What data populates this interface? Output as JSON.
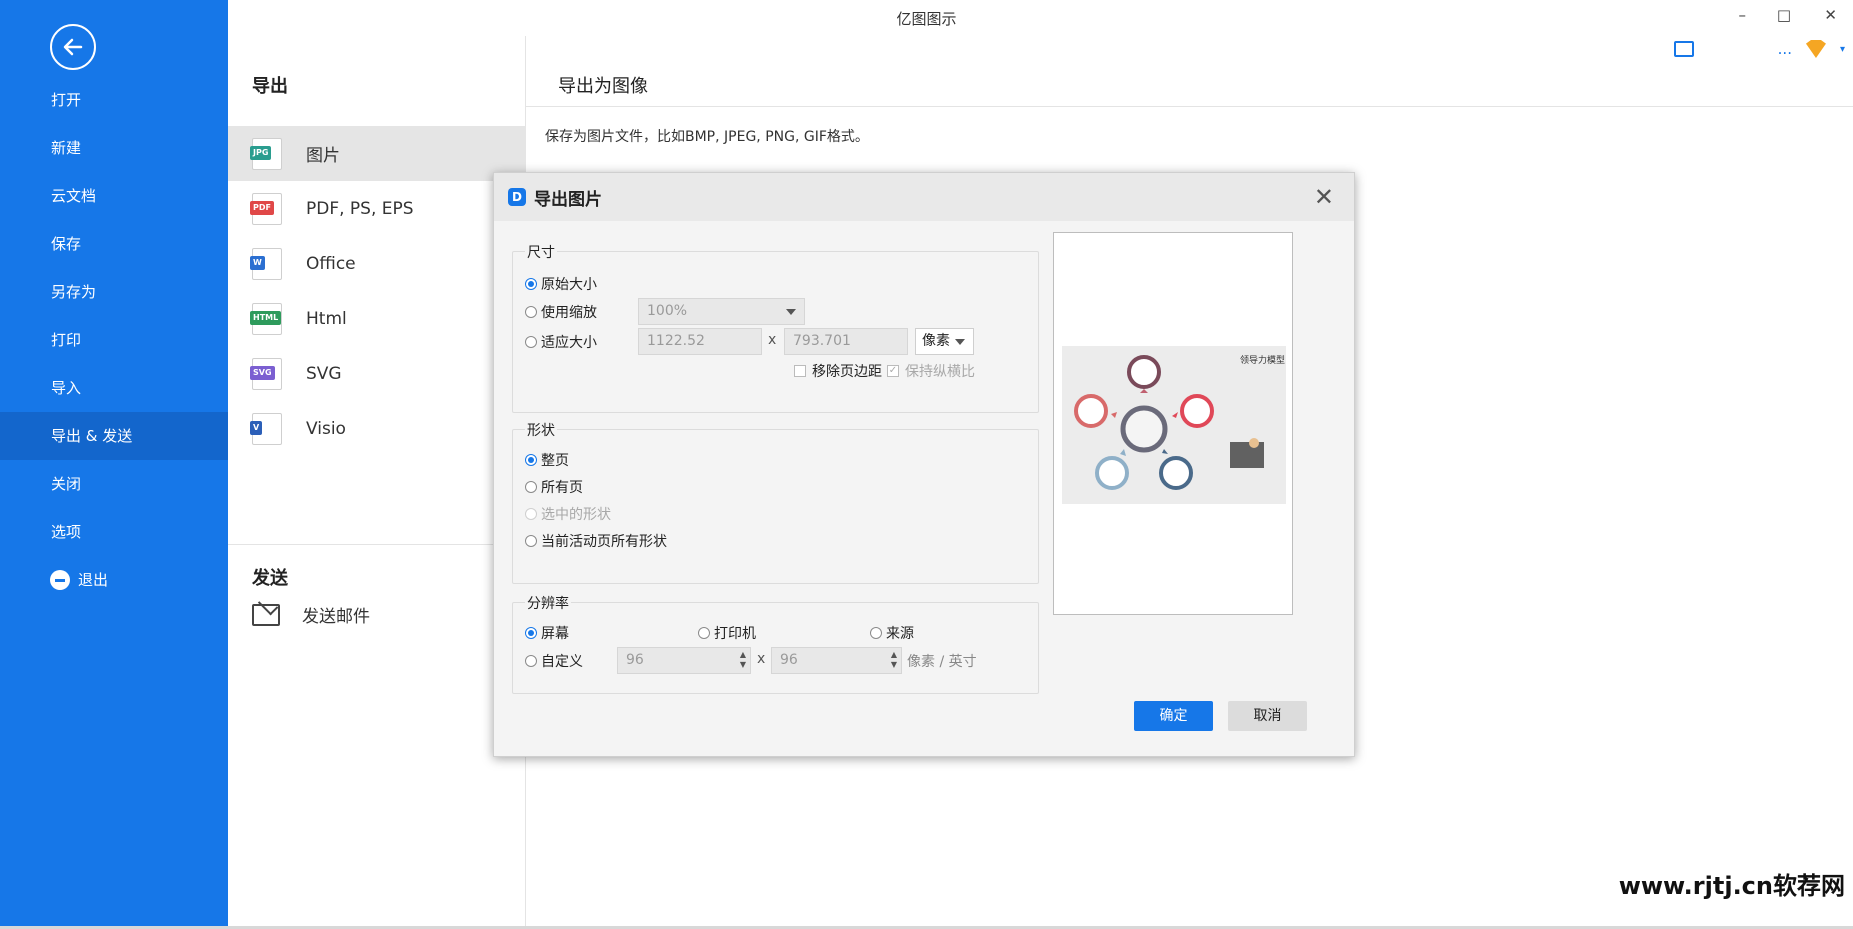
{
  "app": {
    "title": "亿图图示"
  },
  "titlebar": {
    "min": "–",
    "max": "□",
    "close": "✕",
    "more": "...",
    "caret": "▾"
  },
  "sidebar": {
    "items": [
      {
        "label": "打开"
      },
      {
        "label": "新建"
      },
      {
        "label": "云文档"
      },
      {
        "label": "保存"
      },
      {
        "label": "另存为"
      },
      {
        "label": "打印"
      },
      {
        "label": "导入"
      },
      {
        "label": "导出 & 发送",
        "active": true
      },
      {
        "label": "关闭"
      },
      {
        "label": "选项"
      }
    ],
    "exit_label": "退出",
    "accent": "#1677e8"
  },
  "export_panel": {
    "heading": "导出",
    "items": [
      {
        "label": "图片",
        "tag": "JPG",
        "tag_color": "#2a9d8f",
        "active": true
      },
      {
        "label": "PDF, PS, EPS",
        "tag": "PDF",
        "tag_color": "#e04848"
      },
      {
        "label": "Office",
        "tag": "W",
        "tag_color": "#2b6fd1"
      },
      {
        "label": "Html",
        "tag": "HTML",
        "tag_color": "#2e9b5c"
      },
      {
        "label": "SVG",
        "tag": "SVG",
        "tag_color": "#7b5fd1"
      },
      {
        "label": "Visio",
        "tag": "V",
        "tag_color": "#2b5fb8"
      }
    ],
    "send_heading": "发送",
    "send_item": "发送邮件"
  },
  "right": {
    "heading": "导出为图像",
    "description": "保存为图片文件，比如BMP, JPEG, PNG, GIF格式。"
  },
  "dialog": {
    "title": "导出图片",
    "logo": "D",
    "close": "✕",
    "size": {
      "title": "尺寸",
      "original": "原始大小",
      "scale": "使用缩放",
      "scale_value": "100%",
      "fit": "适应大小",
      "width": "1122.52",
      "x": "x",
      "height": "793.701",
      "unit": "像素",
      "remove_margin": "移除页边距",
      "keep_ratio": "保持纵横比"
    },
    "shape": {
      "title": "形状",
      "whole_page": "整页",
      "all_pages": "所有页",
      "selected": "选中的形状",
      "current_active": "当前活动页所有形状"
    },
    "resolution": {
      "title": "分辨率",
      "screen": "屏幕",
      "printer": "打印机",
      "source": "来源",
      "custom": "自定义",
      "dpi_x": "96",
      "x": "x",
      "dpi_y": "96",
      "unit": "像素 / 英寸"
    },
    "preview": {
      "label": "领导力模型"
    },
    "ok": "确定",
    "cancel": "取消"
  },
  "watermark": "www.rjtj.cn软荐网"
}
